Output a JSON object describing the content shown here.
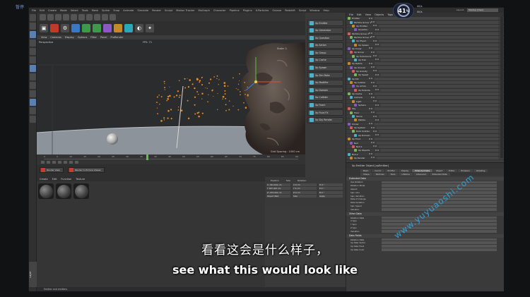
{
  "pause_label": "暂停",
  "timer": {
    "value": "41",
    "unit": "%"
  },
  "network": {
    "up": "0K/s",
    "down": "0K/s"
  },
  "menubar": [
    "File",
    "Edit",
    "Create",
    "Mode",
    "Select",
    "Tools",
    "Mesh",
    "Spline",
    "Snap",
    "Animate",
    "Simulate",
    "Render",
    "Sculpt",
    "Motion Tracker",
    "MoGraph",
    "Character",
    "Pipeline",
    "Plugins",
    "X-Particles",
    "Octane",
    "Redshift",
    "Script",
    "Window",
    "Help"
  ],
  "layout": {
    "label": "Layout:",
    "value": "Startup (User)"
  },
  "viewport": {
    "menu": [
      "View",
      "Cameras",
      "Display",
      "Options",
      "Filter",
      "Panel",
      "ProRender"
    ],
    "label": "Perspective",
    "fps": "FPS: 71",
    "axis": "Scale: 1",
    "scale": "Grid Spacing : 1000 cm"
  },
  "command_panel": [
    "Xp Emitter",
    "Xp Generator",
    "Xp Question",
    "Xp Action",
    "Xp Group",
    "Xp Cache",
    "Xp Spawn",
    "Xp Sim Data",
    "Xp Modifier",
    "Xp Domain",
    "Xp Collider",
    "Xp Foam",
    "Xp Fluid FX",
    "Xp Sky Render"
  ],
  "object_menu": [
    "File",
    "Edit",
    "View",
    "Objects",
    "Tags",
    "Bookmarks"
  ],
  "objects": [
    "Emitter",
    "Particle Group 1",
    "Xp Emitter",
    "Question",
    "Particle Group 2",
    "Particle Group 3",
    "Xp Physic",
    "Xp Spawn",
    "Xp Cover",
    "Xp Group",
    "Xp Turbulence",
    "Xp Trail",
    "Xp Debris",
    "Xp Voronoi",
    "Xp Gravity",
    "Xp Speed",
    "Xp Kill",
    "Xp Collider",
    "Xp Action",
    "Xp Explode",
    "Xp Cache",
    "Camera",
    "Light",
    "Sphere",
    "Sky",
    "Floor",
    "Stone",
    "Pebble",
    "Cloner",
    "Xp System",
    "Rock Scatter",
    "Xp Domain",
    "Xp Fluid",
    "Null",
    "Null.1",
    "Xp Objects",
    "Null.2",
    "Xp Render"
  ],
  "attributes": {
    "title": "Xp Emitter Object [xpEmitter]",
    "tabs": [
      "Basic",
      "Coord.",
      "Emitter",
      "Display",
      "Extended Data",
      "Object",
      "Editor",
      "Emission",
      "Ghosting",
      "Shape",
      "Particles",
      "Tools",
      "Lifetime",
      "Advanced",
      "Extended Data"
    ],
    "active_tab": "Extended Data",
    "sections": [
      {
        "title": "Extended Data",
        "rows": [
          "Use Rotation",
          "Rotation Mode",
          "Aspect",
          "Spin Axis",
          "Spin Variation",
          "Rate of Change",
          "Rate Variation",
          "Spin Speed",
          "Variation"
        ]
      },
      {
        "title": "Other Data",
        "rows": [
          "Rotation Data",
          "X Spin",
          "Y Spin",
          "Z Spin",
          "Variation"
        ]
      },
      {
        "title": "Data Fields",
        "rows": [
          "Rotation Data",
          "Xp Data Vector",
          "Xp Data Float",
          "Xp Data Color"
        ]
      }
    ]
  },
  "timeline": {
    "ticks": [
      "0",
      "5",
      "10",
      "15",
      "20",
      "25",
      "30",
      "35",
      "40",
      "45",
      "50",
      "55",
      "60",
      "65",
      "70",
      "75",
      "80",
      "85",
      "90"
    ]
  },
  "render_buttons": [
    "Render View",
    "Render to Picture Viewer"
  ],
  "material_menu": [
    "Create",
    "Edit",
    "Function",
    "Texture"
  ],
  "materials": [
    "Mat",
    "Mat.1",
    "Mat.2"
  ],
  "coordinates": {
    "headers": [
      "Position",
      "Size",
      "Rotation"
    ],
    "rows": [
      [
        "X  -321.641 cm",
        "X  0 cm",
        "H  0 °"
      ],
      [
        "Y  187.443 cm",
        "Y  0 cm",
        "P  0 °"
      ],
      [
        "Z  -153.941 cm",
        "Z  0 cm",
        "B  0 °"
      ],
      [
        "Object (Rel)",
        "Size",
        "Apply"
      ]
    ]
  },
  "status": "Emitter and emitters",
  "side_tab": "Layer",
  "subtitle_cn": "看看这会是什么样子，",
  "subtitle_en": "see what this would look like",
  "watermark": "www.yuyuaoshi.com"
}
